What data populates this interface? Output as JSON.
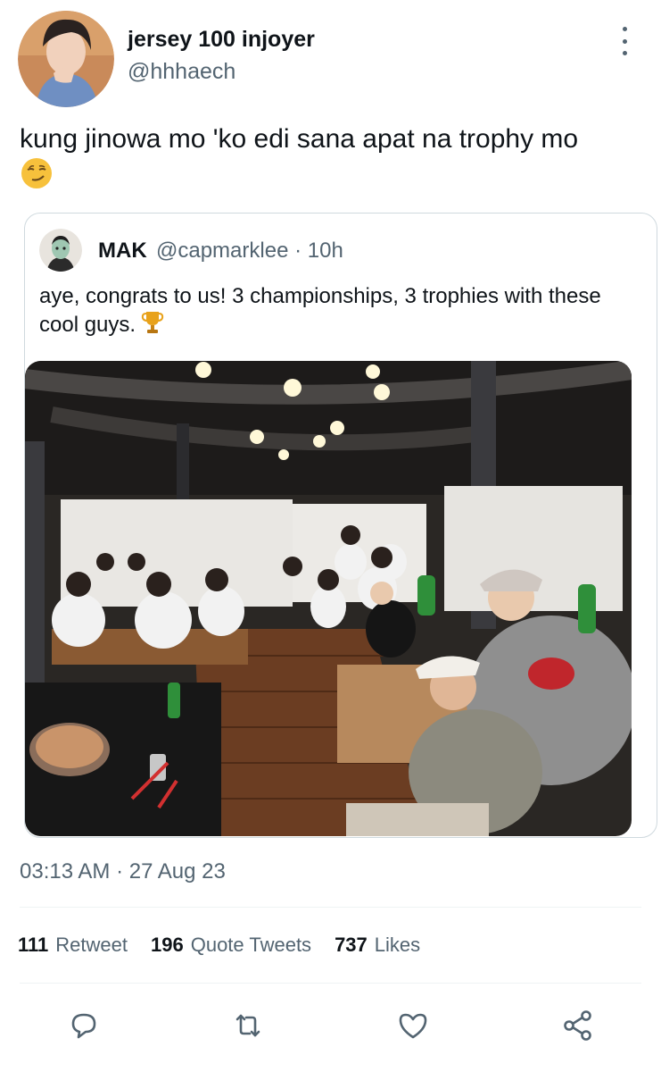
{
  "tweet": {
    "author": {
      "display_name": "jersey 100 injoyer",
      "handle": "@hhhaech"
    },
    "text": "kung jinowa mo 'ko edi sana apat na trophy mo",
    "emoji": "smirking-face",
    "timestamp": "03:13 AM · 27 Aug 23"
  },
  "quote": {
    "author_name": "MAK",
    "author_meta": "@capmarklee · 10h",
    "text": "aye, congrats to us! 3 championships, 3 trophies with these cool guys.",
    "emoji": "trophy",
    "photo_alt": "group photo"
  },
  "stats": [
    {
      "count": "111",
      "label": "Retweet"
    },
    {
      "count": "196",
      "label": "Quote Tweets"
    },
    {
      "count": "737",
      "label": "Likes"
    }
  ],
  "actions": [
    "reply-icon",
    "retweet-icon",
    "like-icon",
    "share-icon"
  ],
  "colors": {
    "text": "#0f1419",
    "secondary": "#536471",
    "border": "#cfd9de",
    "divider": "#eff3f4"
  }
}
